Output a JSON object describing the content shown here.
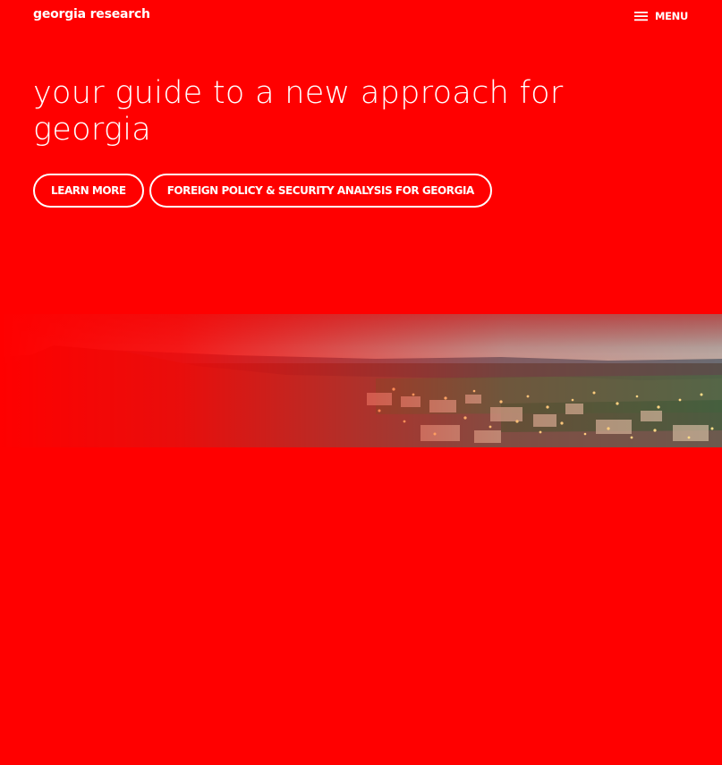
{
  "header": {
    "brand": "georgia research",
    "menu_label": "MENU",
    "menu_icon": "hamburger-icon"
  },
  "hero": {
    "title": "your guide to a new approach for georgia",
    "buttons": [
      {
        "label": "LEARN MORE"
      },
      {
        "label": "FOREIGN POLICY & SECURITY ANALYSIS FOR GEORGIA"
      }
    ]
  },
  "colors": {
    "background": "#ff0000",
    "text": "#ffffff"
  }
}
